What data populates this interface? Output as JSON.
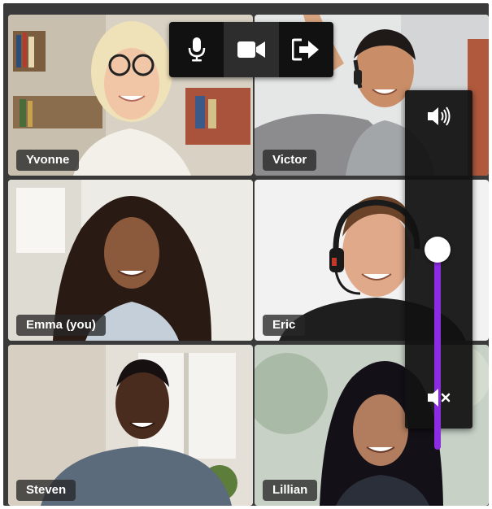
{
  "participants": [
    {
      "name": "Yvonne",
      "active": false
    },
    {
      "name": "Victor",
      "active": false
    },
    {
      "name": "Emma (you)",
      "active": true
    },
    {
      "name": "Eric",
      "active": false
    },
    {
      "name": "Steven",
      "active": false
    },
    {
      "name": "Lillian",
      "active": false
    }
  ],
  "toolbar": {
    "buttons": [
      {
        "icon": "microphone-icon",
        "active": false
      },
      {
        "icon": "camera-icon",
        "active": true
      },
      {
        "icon": "leave-call-icon",
        "active": false
      }
    ]
  },
  "volume": {
    "level": 1.0,
    "top_icon": "speaker-loud-icon",
    "bottom_icon": "speaker-mute-icon"
  },
  "colors": {
    "active_border": "#e6962e",
    "slider_fill": "#8b2be2",
    "tag_bg": "#282828"
  }
}
